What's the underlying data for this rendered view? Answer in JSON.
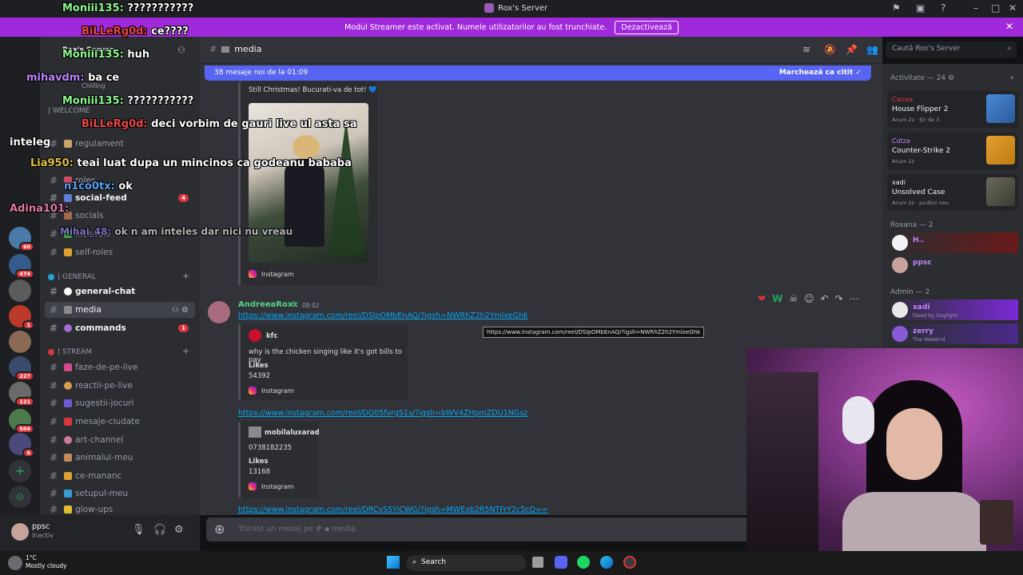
{
  "window": {
    "title": "Rox's Server"
  },
  "banner": {
    "text": "Modul Streamer este activat. Numele utilizatorilor au fost trunchiate.",
    "button": "Dezactivează"
  },
  "server": {
    "name": "Rox's Server"
  },
  "sidebar": {
    "welcome_cat": "| WELCOME",
    "general_cat": "| GENERAL",
    "stream_cat": "| STREAM",
    "channels_top": [
      {
        "label": "regulament"
      },
      {
        "label": "roles"
      },
      {
        "label": "social-feed",
        "badge": "4"
      },
      {
        "label": "socials"
      },
      {
        "label": "kick-role"
      },
      {
        "label": "self-roles"
      }
    ],
    "channels_general": [
      {
        "label": "general-chat"
      },
      {
        "label": "media"
      },
      {
        "label": "commands",
        "badge": "1"
      }
    ],
    "channels_stream": [
      {
        "label": "faze-de-pe-live"
      },
      {
        "label": "reactii-pe-live"
      },
      {
        "label": "sugestii-jocuri"
      },
      {
        "label": "mesaje-ciudate"
      },
      {
        "label": "art-channel"
      },
      {
        "label": "animalul-meu"
      },
      {
        "label": "ce-mananc"
      },
      {
        "label": "setupul-meu"
      },
      {
        "label": "glow-ups"
      }
    ],
    "chilling": "Chilling"
  },
  "rail": {
    "badges": [
      "60",
      "474",
      "1",
      "227",
      "121",
      "504",
      "6"
    ]
  },
  "user": {
    "name": "ppsc",
    "status": "Inactiv"
  },
  "header": {
    "channel": "media",
    "search_placeholder": "Caută Rox's Server"
  },
  "chat": {
    "new_messages": "38 mesaje noi de la 01:09",
    "mark_read": "Marchează ca citit",
    "embed1": {
      "caption": "Still Christmas! Bucurati-va de tot! 💙",
      "source": "Instagram"
    },
    "msg": {
      "author": "AndreeaRoxx",
      "time": "08:02",
      "link1": "https://www.instagram.com/reel/DSIpOMbEnAQ/?igsh=NWRhZ2h2YmlxeGhk",
      "tooltip": "https://www.instagram.com/reel/DSIpOMbEnAQ/?igsh=NWRhZ2h2YmlxeGhk",
      "embed2": {
        "account": "kfc",
        "desc": "why is the chicken singing like it's got bills to pay",
        "likes_label": "Likes",
        "likes": "54392",
        "source": "Instagram"
      },
      "link2": "https://www.instagram.com/reel/DQ05fvrgS1s/?igsh=bWV4ZHpmZDU1NGsz",
      "embed3": {
        "account": "mobilaluxarad",
        "desc": "0738182235",
        "likes_label": "Likes",
        "likes": "13168",
        "source": "Instagram"
      },
      "link3": "https://www.instagram.com/reel/DRCvSSYiCWG/?igsh=MWExb2R5NTFrY2c5cQ=="
    },
    "composer_placeholder": "Trimite un mesaj pe #",
    "composer_channel": "media"
  },
  "activity": {
    "title": "Activitate — 24",
    "cards": [
      {
        "who": "Cwzaa",
        "game": "House Flipper 2",
        "meta": "Acum 2z · Șir de 3"
      },
      {
        "who": "Cotza",
        "game": "Counter-Strike 2",
        "meta": "Acum 1z"
      },
      {
        "who": "xadi",
        "game": "Unsolved Case",
        "meta": "Acum 2z · Jucător nou"
      }
    ],
    "roxana_title": "Roxana — 2",
    "roxana_members": [
      {
        "name": "H..",
        "sub": ""
      },
      {
        "name": "ppsc",
        "sub": ""
      }
    ],
    "admin_title": "Admin — 2",
    "admin_members": [
      {
        "name": "xadi",
        "sub": "Dead by Daylight"
      },
      {
        "name": "zerry",
        "sub": "The Weeknd"
      }
    ]
  },
  "overlay": [
    {
      "user": "Moniii135:",
      "text": "???????????"
    },
    {
      "user": "BiLLeRg0d:",
      "text": "ce????"
    },
    {
      "user": "Moniii135:",
      "text": "huh"
    },
    {
      "user": "mihavdm:",
      "text": "ba ce"
    },
    {
      "user": "Moniii135:",
      "text": "???????????"
    },
    {
      "user": "BiLLeRg0d:",
      "text": "deci vorbim de gauri live ul asta sa"
    },
    {
      "user": "",
      "text": "inteleg"
    },
    {
      "user": "Lia950:",
      "text": "teai luat dupa un mincinos ca godeanu bababa"
    },
    {
      "user": "n1co0tx:",
      "text": "ok"
    },
    {
      "user": "Adina101:",
      "text": ""
    },
    {
      "user": "Mihai_48:",
      "text": "ok n am inteles dar nici nu vreau"
    }
  ],
  "taskbar": {
    "temp": "1°C",
    "weather": "Mostly cloudy",
    "search": "Search"
  }
}
